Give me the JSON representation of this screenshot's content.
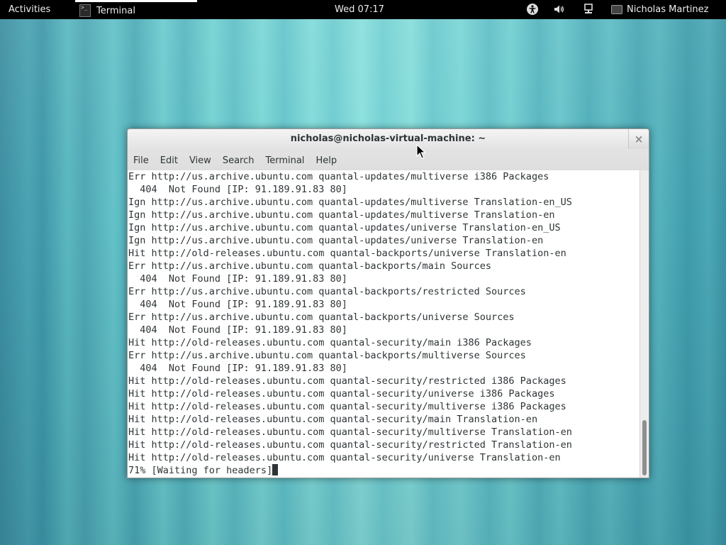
{
  "topbar": {
    "activities_label": "Activities",
    "app_menu_label": "Terminal",
    "app_icon_glyph": ">_",
    "clock": "Wed 07:17",
    "tray_icons": [
      "accessibility-icon",
      "volume-icon",
      "network-icon"
    ],
    "user_name": "Nicholas Martinez"
  },
  "window": {
    "title": "nicholas@nicholas-virtual-machine: ~",
    "close_glyph": "×",
    "menu": [
      "File",
      "Edit",
      "View",
      "Search",
      "Terminal",
      "Help"
    ]
  },
  "terminal": {
    "lines": [
      "Err http://us.archive.ubuntu.com quantal-updates/multiverse i386 Packages",
      "  404  Not Found [IP: 91.189.91.83 80]",
      "Ign http://us.archive.ubuntu.com quantal-updates/multiverse Translation-en_US",
      "Ign http://us.archive.ubuntu.com quantal-updates/multiverse Translation-en",
      "Ign http://us.archive.ubuntu.com quantal-updates/universe Translation-en_US",
      "Ign http://us.archive.ubuntu.com quantal-updates/universe Translation-en",
      "Hit http://old-releases.ubuntu.com quantal-backports/universe Translation-en",
      "Err http://us.archive.ubuntu.com quantal-backports/main Sources",
      "  404  Not Found [IP: 91.189.91.83 80]",
      "Err http://us.archive.ubuntu.com quantal-backports/restricted Sources",
      "  404  Not Found [IP: 91.189.91.83 80]",
      "Err http://us.archive.ubuntu.com quantal-backports/universe Sources",
      "  404  Not Found [IP: 91.189.91.83 80]",
      "Hit http://old-releases.ubuntu.com quantal-security/main i386 Packages",
      "Err http://us.archive.ubuntu.com quantal-backports/multiverse Sources",
      "  404  Not Found [IP: 91.189.91.83 80]",
      "Hit http://old-releases.ubuntu.com quantal-security/restricted i386 Packages",
      "Hit http://old-releases.ubuntu.com quantal-security/universe i386 Packages",
      "Hit http://old-releases.ubuntu.com quantal-security/multiverse i386 Packages",
      "Hit http://old-releases.ubuntu.com quantal-security/main Translation-en",
      "Hit http://old-releases.ubuntu.com quantal-security/multiverse Translation-en",
      "Hit http://old-releases.ubuntu.com quantal-security/restricted Translation-en",
      "Hit http://old-releases.ubuntu.com quantal-security/universe Translation-en"
    ],
    "prompt_line": "71% [Waiting for headers]"
  }
}
